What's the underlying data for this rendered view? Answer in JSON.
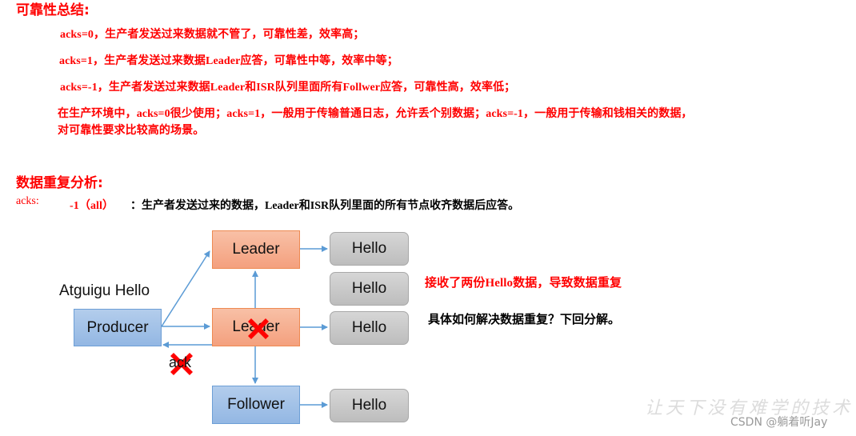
{
  "reliability": {
    "title": "可靠性总结:",
    "lines": [
      "acks=0，生产者发送过来数据就不管了，可靠性差，效率高；",
      "acks=1，生产者发送过来数据Leader应答，可靠性中等，效率中等；",
      "acks=-1，生产者发送过来数据Leader和ISR队列里面所有Follwer应答，可靠性高，效率低；"
    ],
    "summary": [
      "在生产环境中，acks=0很少使用；acks=1，一般用于传输普通日志，允许丢个别数据；acks=-1，一般用于传输和钱相关的数据，",
      "对可靠性要求比较高的场景。"
    ]
  },
  "duplication": {
    "title": "数据重复分析:",
    "acks_label": "acks:",
    "acks_value": "-1（all）",
    "acks_desc": "：生产者发送过来的数据，Leader和ISR队列里面的所有节点收齐数据后应答。"
  },
  "diagram": {
    "message_label": "Atguigu Hello",
    "producer": "Producer",
    "leader_top": "Leader",
    "leader_mid": "Leader",
    "follower": "Follower",
    "hello_boxes": [
      "Hello",
      "Hello",
      "Hello",
      "Hello"
    ],
    "ack_label": "ack",
    "failure_icon": "red-x-icon",
    "note_duplicate": "接收了两份Hello数据，导致数据重复",
    "note_next": "具体如何解决数据重复？下回分解。",
    "colors": {
      "leader_fill": "#f4a07e",
      "leader_border": "#ee8a52",
      "blue_fill": "#93b7e3",
      "blue_border": "#6d9fd6",
      "hello_fill": "#c8c8c8",
      "arrow": "#5b9bd5",
      "failure": "#ff0000"
    }
  },
  "watermark": {
    "slogan": "让天下没有难学的技术",
    "credit": "CSDN @躺着听Jay"
  }
}
